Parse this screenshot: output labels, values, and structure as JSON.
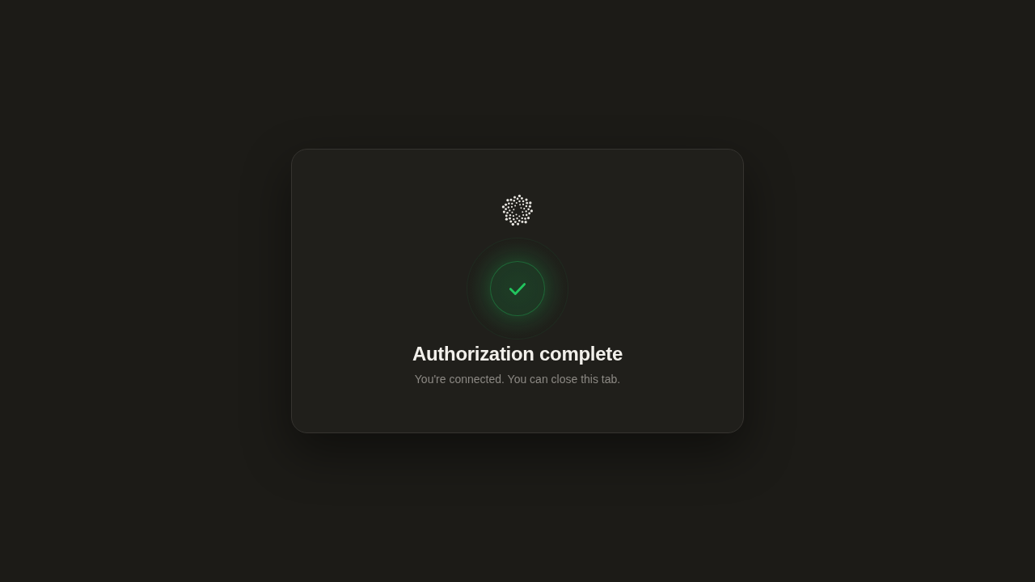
{
  "card": {
    "title": "Authorization complete",
    "message": "You're connected. You can close this tab."
  }
}
